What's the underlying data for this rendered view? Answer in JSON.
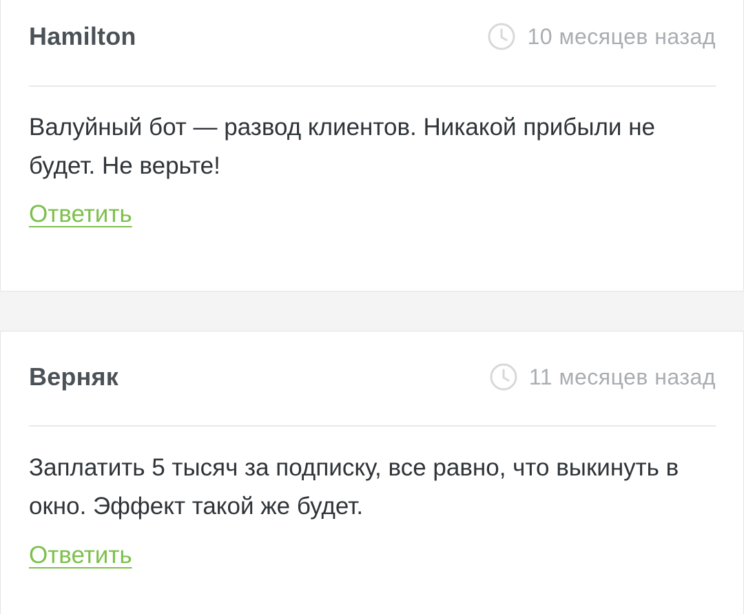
{
  "colors": {
    "author": "#4b5257",
    "meta": "#a9adb1",
    "text": "#2f3438",
    "reply_link": "#7cc04b",
    "background": "#f4f4f4"
  },
  "comments": [
    {
      "author": "Hamilton",
      "time_icon": "clock-icon",
      "time": "10 месяцев назад",
      "text": "Валуйный бот — развод клиентов. Никакой прибыли не будет. Не верьте!",
      "reply_label": "Ответить"
    },
    {
      "author": "Верняк",
      "time_icon": "clock-icon",
      "time": "11 месяцев назад",
      "text": "Заплатить 5 тысяч за подписку, все равно, что выкинуть в окно. Эффект такой же будет.",
      "reply_label": "Ответить"
    }
  ]
}
